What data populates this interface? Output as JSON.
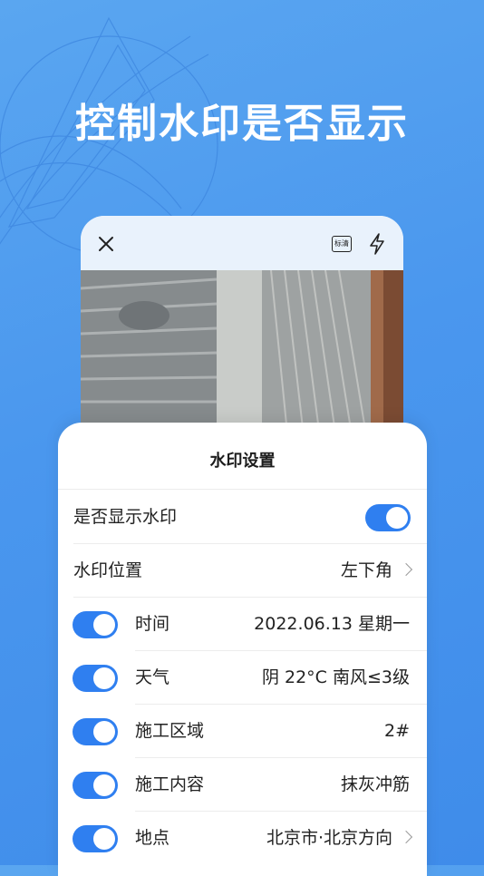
{
  "headline": "控制水印是否显示",
  "camera": {
    "hd_label": "标清"
  },
  "sheet": {
    "title": "水印设置",
    "show_watermark_label": "是否显示水印",
    "show_watermark_on": true,
    "position_label": "水印位置",
    "position_value": "左下角",
    "items": [
      {
        "label": "时间",
        "value": "2022.06.13 星期一",
        "on": true
      },
      {
        "label": "天气",
        "value": "阴 22°C 南风≤3级",
        "on": true
      },
      {
        "label": "施工区域",
        "value": "2#",
        "on": true
      },
      {
        "label": "施工内容",
        "value": "抹灰冲筋",
        "on": true
      },
      {
        "label": "地点",
        "value": "北京市·北京方向",
        "on": true
      }
    ]
  },
  "colors": {
    "accent": "#2f7ff0",
    "background": "#4a97ee"
  }
}
